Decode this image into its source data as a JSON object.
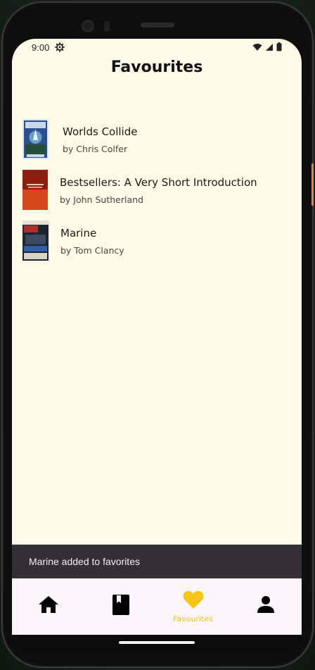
{
  "status_bar": {
    "time": "9:00",
    "icons": [
      "gear-icon",
      "wifi-icon",
      "signal-icon",
      "battery-icon"
    ]
  },
  "header": {
    "title": "Favourites"
  },
  "favourites": [
    {
      "title": "Worlds Collide",
      "author": "by Chris Colfer",
      "cover_colors": [
        "#2c4f8f",
        "#6aa0c8"
      ]
    },
    {
      "title": "Bestsellers: A Very Short Introduction",
      "author": "by John Sutherland",
      "cover_colors": [
        "#8c1d10",
        "#d6491f"
      ]
    },
    {
      "title": "Marine",
      "author": "by Tom Clancy",
      "cover_colors": [
        "#1b2430",
        "#b22d2a"
      ]
    }
  ],
  "snackbar": {
    "message": "Marine added to favorites"
  },
  "bottom_nav": {
    "items": [
      {
        "icon": "home-icon",
        "label": "",
        "selected": false
      },
      {
        "icon": "book-icon",
        "label": "",
        "selected": false
      },
      {
        "icon": "heart-icon",
        "label": "Favourites",
        "selected": true
      },
      {
        "icon": "person-icon",
        "label": "",
        "selected": false
      }
    ],
    "active_color": "#f5c518"
  },
  "colors": {
    "background": "#fffbe8",
    "snackbar": "#322f35",
    "navbar": "#fcf5fb"
  }
}
